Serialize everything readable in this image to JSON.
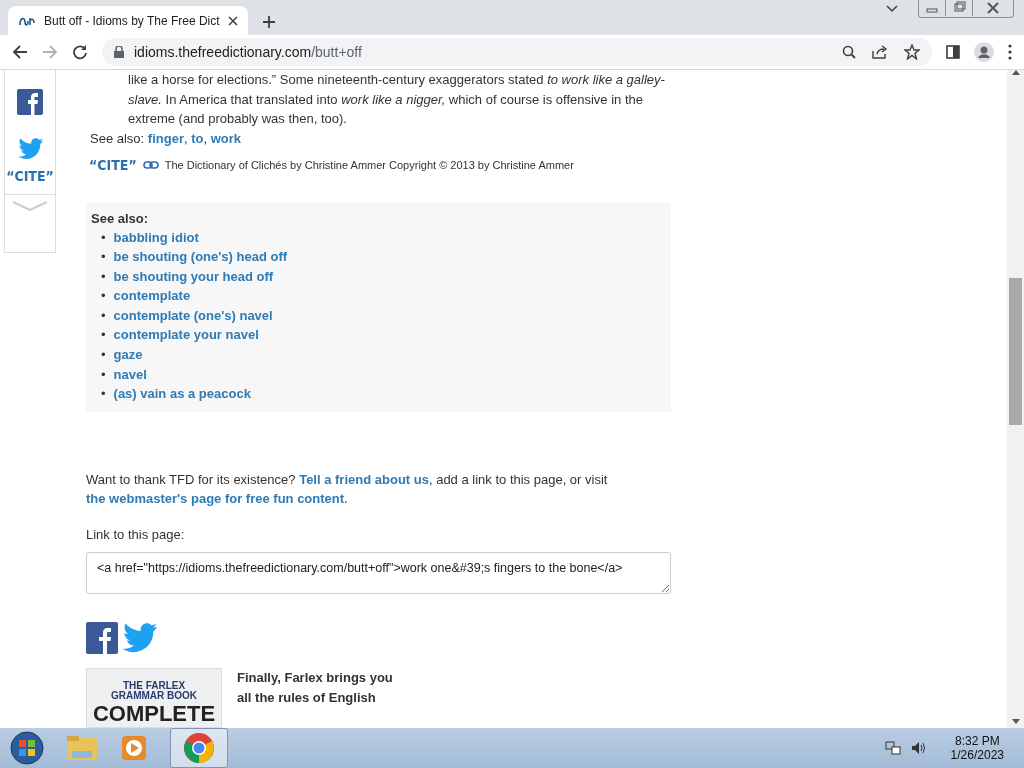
{
  "browser": {
    "tab_title": "Butt off - Idioms by The Free Dict",
    "url_host": "idioms.thefreedictionary.com",
    "url_path": "/butt+off"
  },
  "share_rail": {
    "cite": "“CITE”"
  },
  "entry": {
    "definition": "like a horse for elections.” Some nineteenth-century exaggerators stated *to work like a galley-slave.* In America that translated into *work like a nigger,* which of course is offensive in the extreme (and probably was then, too).",
    "see_also_label": "See also:",
    "see_also_parts": [
      {
        "text": "finger",
        "link": true
      },
      {
        "text": ", ",
        "link": false
      },
      {
        "text": "to",
        "link": true
      },
      {
        "text": ", ",
        "link": false
      },
      {
        "text": "work",
        "link": true
      }
    ],
    "cite_badge": "“CITE”",
    "source": "The Dictionary of Clichés by Christine Ammer Copyright © 2013 by Christine Ammer"
  },
  "related": {
    "title": "See also:",
    "bullet": "•",
    "items": [
      "babbling idiot",
      "be shouting (one's) head off",
      "be shouting your head off",
      "contemplate",
      "contemplate (one's) navel",
      "contemplate your navel",
      "gaze",
      "navel",
      "(as) vain as a peacock"
    ]
  },
  "thanks": [
    {
      "text": "Want to thank TFD for its existence? ",
      "link": false
    },
    {
      "text": "Tell a friend about us",
      "link": true
    },
    {
      "text": ", add a link to this page, or visit ",
      "link": false
    },
    {
      "text": "the webmaster's page for free fun content",
      "link": true
    },
    {
      "text": ".",
      "link": false
    }
  ],
  "link_label": "Link to this page:",
  "link_code": "<a href=\"https://idioms.thefreedictionary.com/butt+off\">work one&#39;s fingers to the bone</a>",
  "promo": {
    "cover_lines": [
      "THE FARLEX",
      "GRAMMAR BOOK",
      "COMPLETE"
    ],
    "text_lines": [
      "Finally, Farlex brings you",
      "all the rules of English"
    ]
  },
  "taskbar": {
    "time": "8:32 PM",
    "date": "1/26/2023"
  }
}
